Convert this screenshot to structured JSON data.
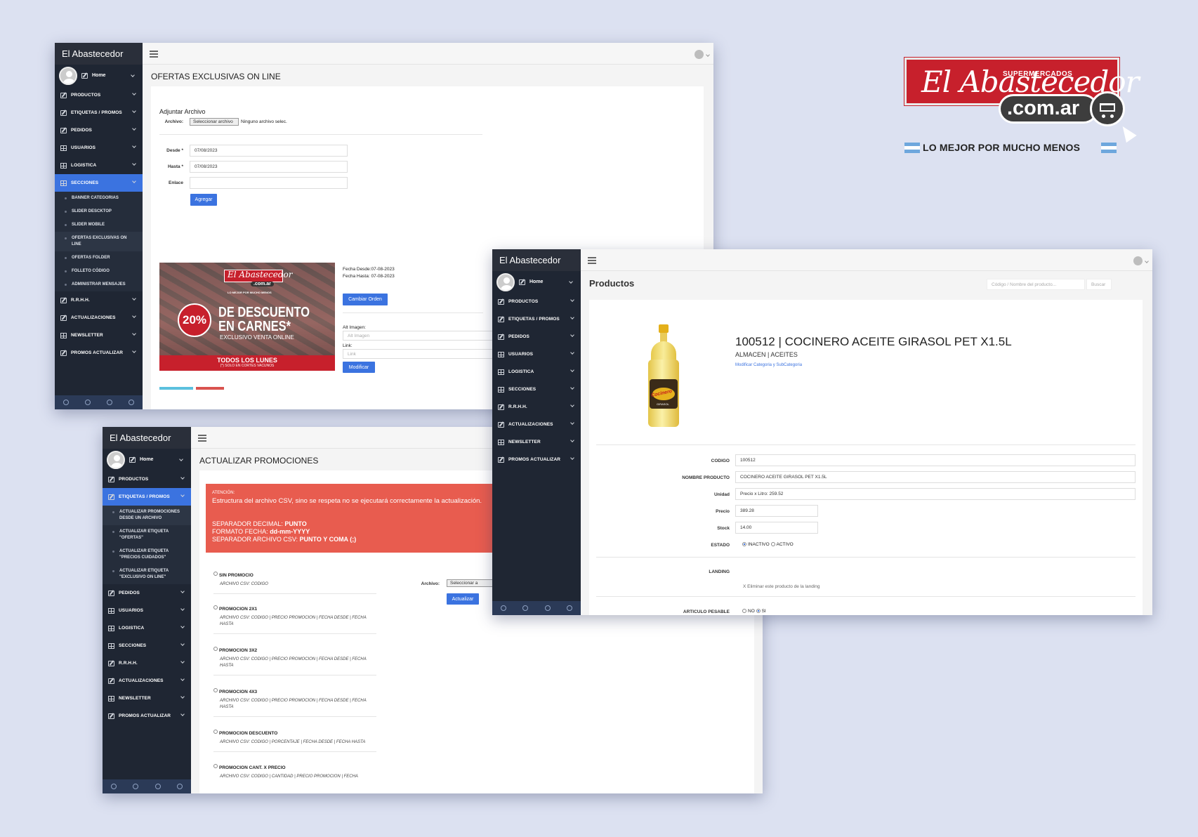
{
  "brand": {
    "super": "SUPERMERCADOS",
    "name": "El Abastecedor",
    "domain": ".com.ar",
    "slogan": "LO MEJOR POR MUCHO MENOS",
    "red": "#c7202c",
    "dark": "#3d3d3d",
    "flag_blue": "#6ea7dd"
  },
  "colors": {
    "primary": "#3b73e0",
    "sidebar": "#1f2633",
    "alert": "#e85c4f"
  },
  "common": {
    "app_title": "El Abastecedor",
    "home": "Home",
    "menu": {
      "productos": "PRODUCTOS",
      "etiquetas": "ETIQUETAS / PROMOS",
      "pedidos": "PEDIDOS",
      "usuarios": "USUARIOS",
      "logistica": "LOGISTICA",
      "secciones": "SECCIONES",
      "rrhh": "R.R.H.H.",
      "actualizaciones": "ACTUALIZACIONES",
      "newsletter": "NEWSLETTER",
      "promos": "PROMOS ACTUALIZAR"
    }
  },
  "w1": {
    "page_title": "OFERTAS EXCLUSIVAS ON LINE",
    "secciones_sub": [
      "BANNER CATEGORIAS",
      "SLIDER DESCKTOP",
      "SLIDER MOBILE",
      "OFERTAS EXCLUSIVAS ON LINE",
      "OFERTAS FOLDER",
      "FOLLETO CÓDIGO",
      "ADMINISTRAR MENSAJES"
    ],
    "form": {
      "heading": "Adjuntar Archivo",
      "archivo_label": "Archivo:",
      "file_button": "Seleccionar archivo",
      "file_status": "Ninguno archivo selec.",
      "desde_label": "Desde *",
      "desde_value": "07/08/2023",
      "hasta_label": "Hasta *",
      "hasta_value": "07/08/2023",
      "enlace_label": "Enlace",
      "agregar": "Agregar"
    },
    "banner": {
      "logo_name": "El Abastecedor",
      "logo_domain": ".com.ar",
      "logo_slogan": "LO MEJOR POR MUCHO MENOS",
      "percent": "20%",
      "line1": "DE DESCUENTO",
      "line2": "EN CARNES*",
      "line3": "EXCLUSIVO VENTA ONLINE",
      "footer1": "TODOS LOS LUNES",
      "footer2": "(*) SOLO EN CORTES VACUNOS"
    },
    "item": {
      "fecha_desde": "Fecha Desde:07-08-2023",
      "fecha_hasta": "Fecha Hasta: 07-08-2023",
      "cambiar_orden": "Cambiar Orden",
      "alt_label": "Alt Imagen:",
      "alt_placeholder": "Alt Imagen",
      "link_label": "Link:",
      "link_placeholder": "Link",
      "modificar": "Modificar"
    }
  },
  "w3": {
    "page_title": "ACTUALIZAR PROMOCIONES",
    "etiquetas_sub": [
      "ACTUALIZAR PROMOCIONES DESDE UN ARCHIVO",
      "ACTUALIZAR ETIQUETA \"OFERTAS\"",
      "ACTUALIZAR ETIQUETA \"PRECIOS CUIDADOS\"",
      "ACTUALIZAR ETIQUETA \"EXCLUSIVO ON LINE\""
    ],
    "alert": {
      "title": "ATENCIÓN:",
      "body": "Estructura del archivo CSV, sino se respeta no se ejecutará correctamente la actualización.",
      "line1_label": "SEPARADOR DECIMAL:",
      "line1_value": "PUNTO",
      "line2_label": "FORMATO FECHA:",
      "line2_value": "dd-mm-YYYY",
      "line3_label": "SEPARADOR ARCHIVO CSV:",
      "line3_value": "PUNTO Y COMA (;)"
    },
    "options": [
      {
        "title": "SIN PROMOCIO",
        "desc": "ARCHIVO CSV: CODIGO"
      },
      {
        "title": "PROMOCION 2X1",
        "desc": "ARCHIVO CSV: CODIGO | PRECIO PROMOCION | FECHA DESDE | FECHA HASTA"
      },
      {
        "title": "PROMOCION 3X2",
        "desc": "ARCHIVO CSV: CODIGO | PRECIO PROMOCION | FECHA DESDE | FECHA HASTA"
      },
      {
        "title": "PROMOCION 4X3",
        "desc": "ARCHIVO CSV: CODIGO | PRECIO PROMOCION | FECHA DESDE | FECHA HASTA"
      },
      {
        "title": "PROMOCION DESCUENTO",
        "desc": "ARCHIVO CSV: CODIGO | PORCENTAJE | FECHA DESDE | FECHA HASTA"
      },
      {
        "title": "PROMOCION CANT. X PRECIO",
        "desc": "ARCHIVO CSV: CODIGO | CANTIDAD | PRECIO PROMOCION | FECHA"
      }
    ],
    "archivo_label": "Archivo:",
    "file_button": "Seleccionar a",
    "actualizar": "Actualizar"
  },
  "w2": {
    "page_title": "Productos",
    "search_placeholder": "Código / Nombre del producto...",
    "search_button": "Buscar",
    "product": {
      "title": "100512 | COCINERO ACEITE GIRASOL PET X1.5L",
      "category": "ALMACEN | ACEITES",
      "modify_link": "Modificar Categoria y SubCategoria",
      "bottle_brand": "Cocinero",
      "bottle_sub": "GIRASOL"
    },
    "fields": {
      "codigo_label": "CODIGO",
      "codigo": "100512",
      "nombre_label": "NOMBRE PRODUCTO",
      "nombre": "COCINERO ACEITE GIRASOL PET  X1.5L",
      "unidad_label": "Unidad",
      "unidad": "Precio x Litro: 259.52",
      "precio_label": "Precio",
      "precio": "389.28",
      "stock_label": "Stock",
      "stock": "14.00",
      "estado_label": "ESTADO",
      "estado_inactivo": "INACTIVO",
      "estado_activo": "ACTIVO",
      "landing_label": "LANDING",
      "landing_remove": "X Eliminar este producto de la landing",
      "pesable_label": "ARTICULO PESABLE",
      "pesable_no": "NO",
      "pesable_si": "SI"
    }
  }
}
